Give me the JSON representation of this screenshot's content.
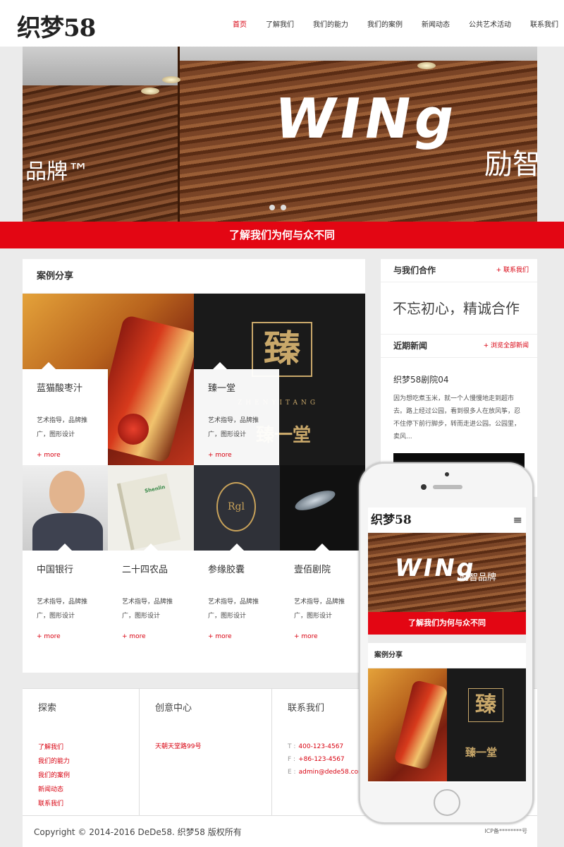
{
  "header": {
    "logo": "织梦58",
    "nav": [
      "首页",
      "了解我们",
      "我们的能力",
      "我们的案例",
      "新闻动态",
      "公共艺术活动",
      "联系我们"
    ]
  },
  "banner": {
    "brand": "WINg",
    "brand_cn": "励智",
    "brand_left": "品牌™"
  },
  "red_bar": "了解我们为何与众不同",
  "cases": {
    "title": "案例分享",
    "items": [
      {
        "name": "蓝猫酸枣汁",
        "desc": "艺术指导，品牌推广，图形设计",
        "more": "+ more"
      },
      {
        "name": "臻一堂",
        "desc": "艺术指导，品牌推广，图形设计",
        "more": "+ more"
      },
      {
        "name": "中国银行",
        "desc": "艺术指导，品牌推广，图形设计",
        "more": "+ more"
      },
      {
        "name": "二十四农品",
        "desc": "艺术指导，品牌推广，图形设计",
        "more": "+ more"
      },
      {
        "name": "参缘胶囊",
        "desc": "艺术指导，品牌推广，图形设计",
        "more": "+ more"
      },
      {
        "name": "壹佰剧院",
        "desc": "艺术指导，品牌推广，图形设计",
        "more": "+ more"
      }
    ]
  },
  "sidebar": {
    "coop_title": "与我们合作",
    "coop_link": "+ 联系我们",
    "slogan": "不忘初心，精诚合作",
    "news_title": "近期新闻",
    "news_link": "+ 浏览全部新闻",
    "news_item_title": "织梦58剧院04",
    "news_item_desc": "因为想吃煮玉米，就一个人慢慢地走到超市去。路上经过公园，看到很多人在放风筝，忍不住停下前行脚步，转而走进公园。公园里，卖风..."
  },
  "footer": {
    "explore_title": "探索",
    "explore_links": [
      "了解我们",
      "我们的能力",
      "我们的案例",
      "新闻动态",
      "联系我们"
    ],
    "creative_title": "创意中心",
    "creative_address": "天朝天堂路99号",
    "contact_title": "联系我们",
    "contacts": [
      {
        "label": "T :",
        "value": "400-123-4567"
      },
      {
        "label": "F :",
        "value": "+86-123-4567"
      },
      {
        "label": "E :",
        "value": "admin@dede58.com"
      }
    ],
    "copyright": "Copyright © 2014-2016 DeDe58. 织梦58 版权所有",
    "icp": "ICP备********号"
  },
  "mobile": {
    "logo": "织梦58",
    "menu_icon": "≡",
    "brand": "WINg",
    "brand_cn": "励智品牌",
    "red_bar": "了解我们为何与众不同",
    "cases_title": "案例分享"
  },
  "colors": {
    "accent": "#e30613",
    "link": "#d8000f"
  },
  "tile_texts": {
    "seal": "臻",
    "seal_word": "ZHENYITANG",
    "seal_big": "臻一堂",
    "rgl": "Rgl",
    "book": "Shenlin"
  }
}
